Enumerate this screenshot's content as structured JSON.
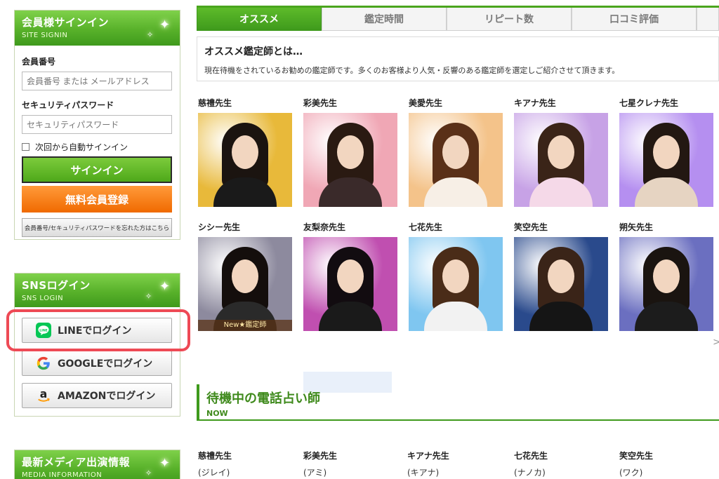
{
  "signin": {
    "title": "会員様サインイン",
    "subtitle": "SITE SIGNIN",
    "member_label": "会員番号",
    "member_placeholder": "会員番号 または メールアドレス",
    "password_label": "セキュリティパスワード",
    "password_placeholder": "セキュリティパスワード",
    "auto_signin": "次回から自動サインイン",
    "signin_button": "サインイン",
    "register_button": "無料会員登録",
    "forgot_button": "会員番号/セキュリティパスワードを忘れた方はこちら"
  },
  "sns": {
    "title": "SNSログイン",
    "subtitle": "SNS LOGIN",
    "line": "LINEでログイン",
    "google": "GOOGLEでログイン",
    "amazon": "AMAZONでログイン",
    "line_icon_text": "LINE"
  },
  "media": {
    "title": "最新メディア出演情報",
    "subtitle": "MEDIA INFORMATION"
  },
  "tabs": [
    "オススメ",
    "鑑定時間",
    "リピート数",
    "口コミ評価"
  ],
  "intro": {
    "heading": "オススメ鑑定師とは…",
    "text": "現在待機をされているお勧めの鑑定師です。多くのお客様より人気・反響のある鑑定師を選定しご紹介させて頂きます。"
  },
  "advisors": [
    {
      "name": "慈禮先生",
      "bg": "#e8b93a",
      "hair": "#1b1410",
      "outfit": "#1a1a1a"
    },
    {
      "name": "彩美先生",
      "bg": "#f0a7b5",
      "hair": "#2a1a12",
      "outfit": "#3a2a2a"
    },
    {
      "name": "美愛先生",
      "bg": "#f4c38a",
      "hair": "#5a3018",
      "outfit": "#f7efe6"
    },
    {
      "name": "キアナ先生",
      "bg": "#c7a2e6",
      "hair": "#3a2418",
      "outfit": "#f5d9e8"
    },
    {
      "name": "七星クレナ先生",
      "bg": "#b58ff0",
      "hair": "#231812",
      "outfit": "#e6d4c2"
    },
    {
      "name": "シシー先生",
      "bg": "#8d8a9e",
      "hair": "#140e0c",
      "outfit": "#2a2a2a"
    },
    {
      "name": "友梨奈先生",
      "bg": "#c04fb0",
      "hair": "#120c10",
      "outfit": "#1a1a1a"
    },
    {
      "name": "七花先生",
      "bg": "#7fc6f0",
      "hair": "#4a2c18",
      "outfit": "#f2f2f2"
    },
    {
      "name": "笑空先生",
      "bg": "#2a4a8c",
      "hair": "#3a2418",
      "outfit": "#151515"
    },
    {
      "name": "朔矢先生",
      "bg": "#6b6fc0",
      "hair": "#1a1410",
      "outfit": "#1c1c1c"
    }
  ],
  "new_badge": "New★鑑定師",
  "next_arrow": ">",
  "now": {
    "title": "待機中の電話占い師",
    "subtitle": "NOW"
  },
  "waiting": [
    {
      "name": "慈禮先生",
      "kana": "(ジレイ)"
    },
    {
      "name": "彩美先生",
      "kana": "(アミ)"
    },
    {
      "name": "キアナ先生",
      "kana": "(キアナ)"
    },
    {
      "name": "七花先生",
      "kana": "(ナノカ)"
    },
    {
      "name": "笑空先生",
      "kana": "(ワク)"
    }
  ]
}
